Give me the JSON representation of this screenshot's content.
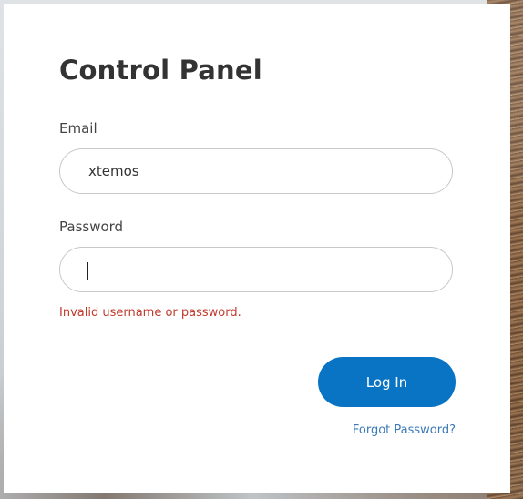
{
  "login": {
    "title": "Control Panel",
    "email_label": "Email",
    "email_value": "xtemos",
    "password_label": "Password",
    "password_value": "",
    "error_message": "Invalid username or password.",
    "login_button": "Log In",
    "forgot_password": "Forgot Password?"
  },
  "colors": {
    "primary": "#0a74c4",
    "error": "#c0392b",
    "link": "#3a79b7"
  }
}
